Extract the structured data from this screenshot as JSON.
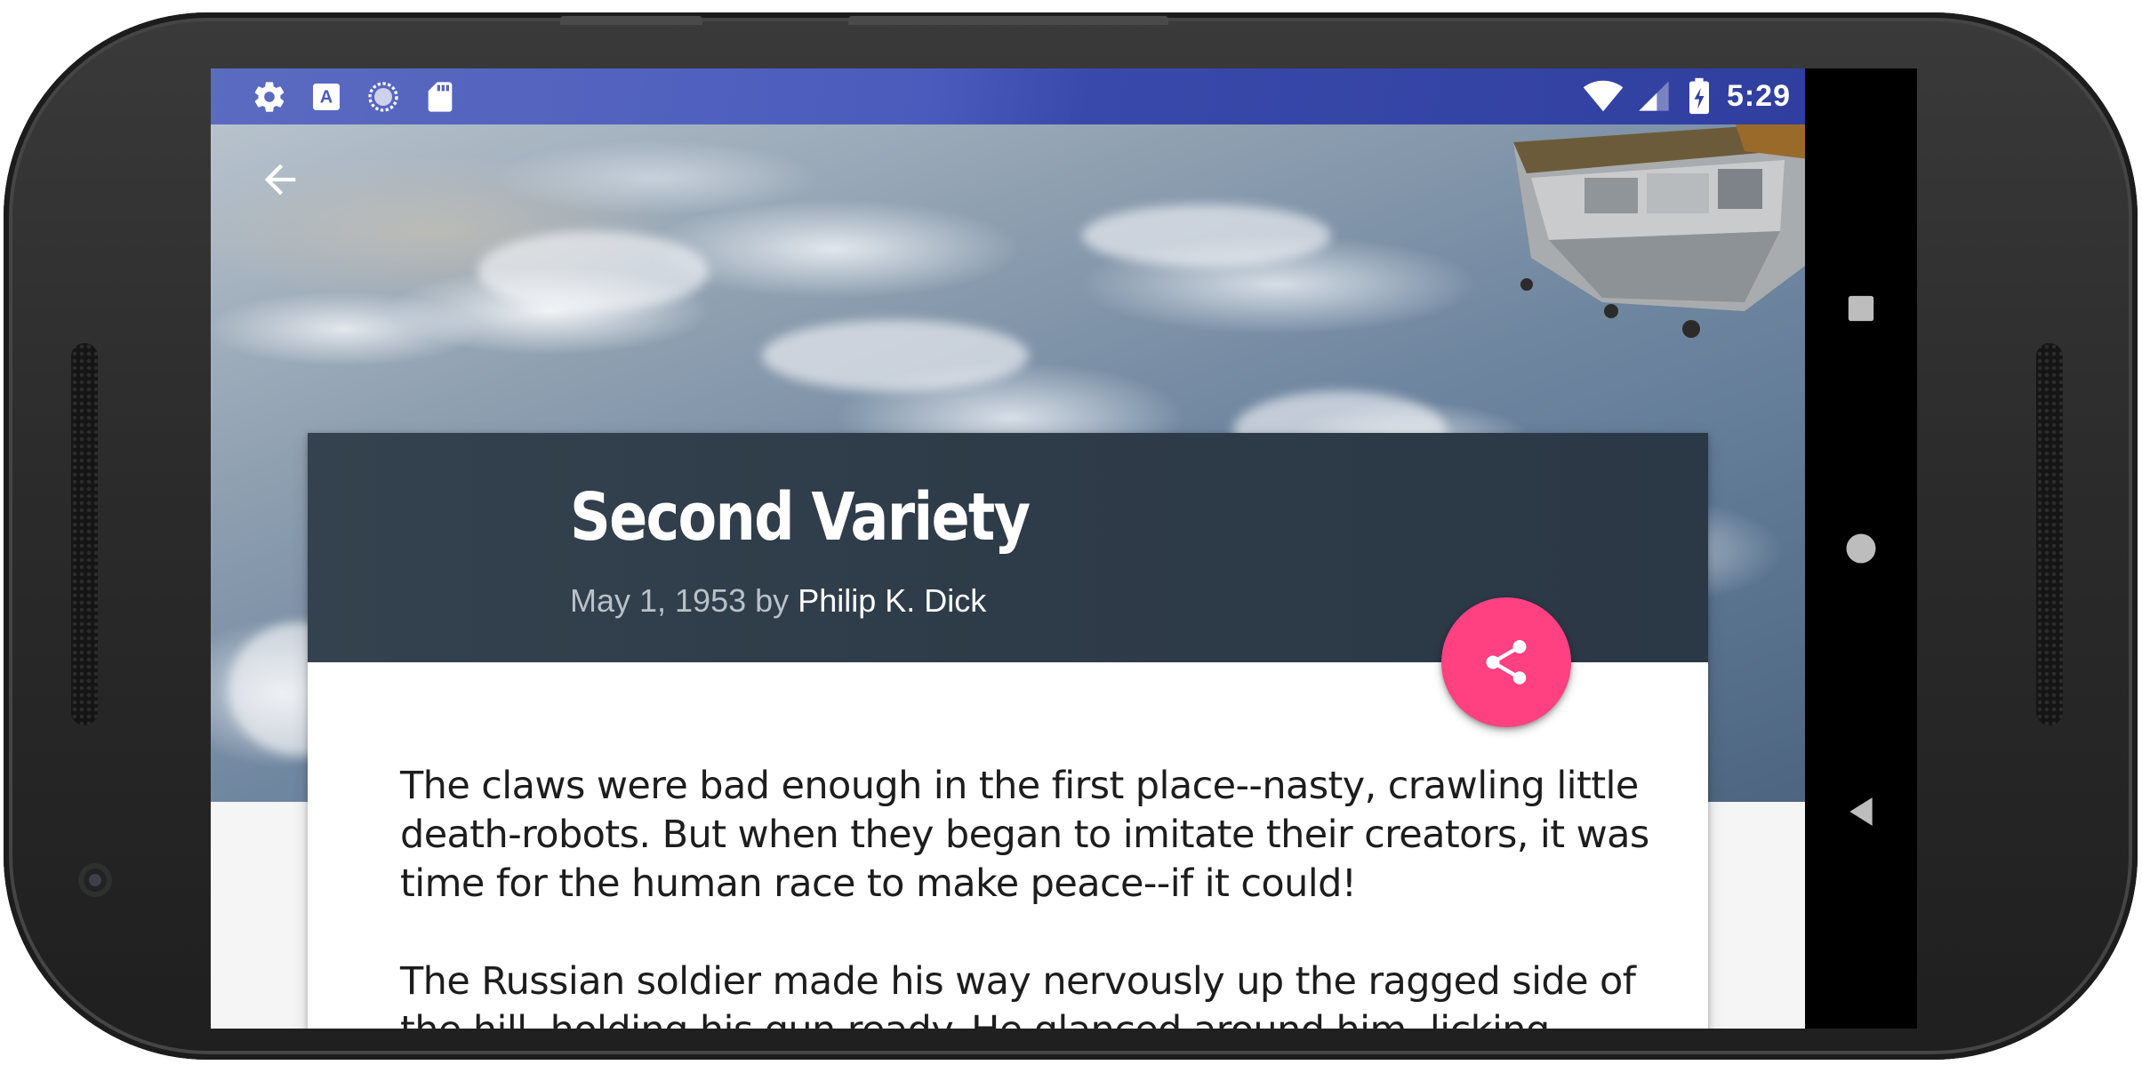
{
  "status_bar": {
    "time": "5:29",
    "left_icons": [
      "settings-icon",
      "text-a-icon",
      "sync-circle-icon",
      "sd-card-icon"
    ],
    "right_icons": [
      "wifi-icon",
      "cell-signal-icon",
      "battery-charging-icon"
    ]
  },
  "toolbar": {
    "back_icon": "arrow-back-icon"
  },
  "article": {
    "title": "Second Variety",
    "date": "May 1, 1953",
    "by": "by",
    "author": "Philip K. Dick",
    "paragraphs": [
      "The claws were bad enough in the first place--nasty, crawling little death-robots. But when they began to imitate their creators, it was time for the human race to make peace--if it could!",
      "The Russian soldier made his way nervously up the ragged side of the hill, holding his gun ready. He glanced around him, licking"
    ]
  },
  "fab": {
    "icon": "share-icon",
    "color": "#FF4081"
  },
  "nav_bar": {
    "buttons": [
      "recents-square-icon",
      "home-circle-icon",
      "back-triangle-icon"
    ]
  },
  "colors": {
    "status_bar": "#3949AB",
    "card_header": "#2E3B48",
    "accent": "#FF4081"
  }
}
